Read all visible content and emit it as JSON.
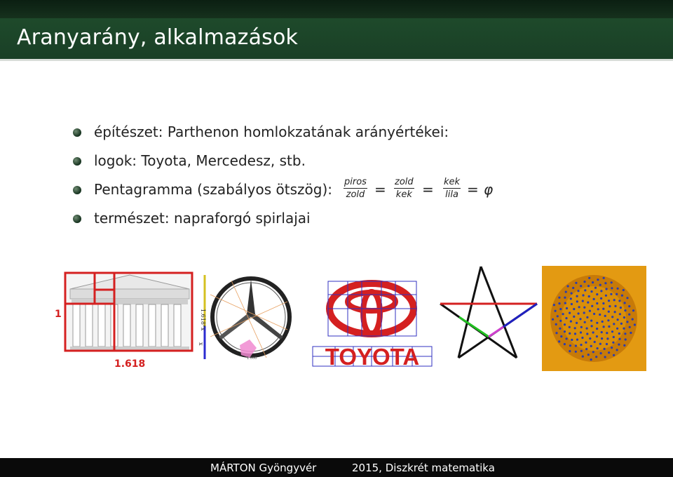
{
  "title": "Aranyarány, alkalmazások",
  "bullets": [
    "építészet: Parthenon homlokzatának arányértékei:",
    "logok: Toyota, Mercedesz, stb.",
    "Pentagramma (szabályos ötszög):",
    "természet: napraforgó spirlajai"
  ],
  "formula": {
    "f1_num": "piros",
    "f1_den": "zold",
    "f2_num": "zold",
    "f2_den": "kek",
    "f3_num": "kek",
    "f3_den": "lila",
    "eq": "=",
    "phi": "φ"
  },
  "parthenon": {
    "label_height": "1",
    "label_width": "1.618"
  },
  "mercedes": {
    "label_long": "1.618*x",
    "label_short": "x",
    "label_small": "1.000"
  },
  "toyota": {
    "word": "TOYOTA"
  },
  "footer": {
    "author": "MÁRTON Gyöngyvér",
    "course": "2015, Diszkrét matematika"
  },
  "colors": {
    "title_bg": "#1e4a2b",
    "accent_red": "#d42020"
  }
}
